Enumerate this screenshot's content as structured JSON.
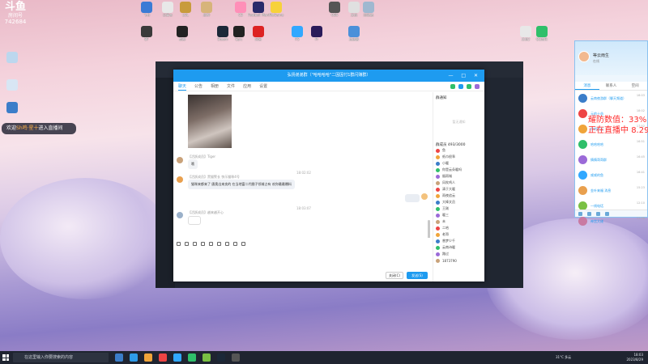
{
  "logo": {
    "title": "斗鱼",
    "room_label": "房间号",
    "room_id": "742684"
  },
  "desktop_icons": [
    {
      "label": "飞书",
      "color": "#3a7bd5"
    },
    {
      "label": "记事本",
      "color": "#e8e8e8"
    },
    {
      "label": "LOL",
      "color": "#c89b3c"
    },
    {
      "label": "原神",
      "color": "#d7b47a"
    },
    {
      "label": "CS",
      "color": "#ff8fb8"
    },
    {
      "label": "Football Manager",
      "color": "#2a2a6a"
    },
    {
      "label": "WeGame",
      "color": "#f7d23a"
    },
    {
      "label": "OBS",
      "color": "#555"
    },
    {
      "label": "文档",
      "color": "#e0e0e0"
    },
    {
      "label": "回收站",
      "color": "#9fb8d0"
    },
    {
      "label": "BF",
      "color": "#3a3a3a"
    },
    {
      "label": "剪映",
      "color": "#222"
    },
    {
      "label": "Steam",
      "color": "#1b2838"
    },
    {
      "label": "Epic",
      "color": "#222"
    },
    {
      "label": "网易",
      "color": "#d22"
    },
    {
      "label": "PS",
      "color": "#31a8ff"
    },
    {
      "label": "Pr",
      "color": "#2a1b5a"
    },
    {
      "label": "加速器",
      "color": "#4a90d9"
    },
    {
      "label": "文档2",
      "color": "#e8e8e8"
    },
    {
      "label": "QQ音乐",
      "color": "#2fbf6a"
    }
  ],
  "overlay": {
    "prefix": "欢迎",
    "user": "Sh鸣·星十",
    "suffix": "进入直播间"
  },
  "chat": {
    "title": "弘扬弟弟群（\"哈哈哈哈\"二因因付1群闪赚群）",
    "tabs": [
      "聊天",
      "公告",
      "相册",
      "文件",
      "应用",
      "设置"
    ],
    "messages": [
      {
        "meta": "【活跃成员】Tiger",
        "text": "哦"
      },
      {
        "meta": "【活跃成员】黑猫警长  快乐猫咪4号",
        "text": "猫咪来都来了 唐奥出来卖的 在当地富二代圈子领域占有 欢你最最爆料"
      },
      {
        "meta": "【活跃成员】越来越开心",
        "text": ""
      }
    ],
    "time1": "18:02:02",
    "time2": "18:03:07",
    "close_label": "关闭(C)",
    "send_label": "发送(S)",
    "notice_title": "群通知",
    "notice_empty": "暂无通知",
    "members_title": "群成员 493/3000",
    "members": [
      "鱼",
      "纸巾很乖",
      "小暖",
      "你是云朵暖吗",
      "烟雨城",
      "风吹鸡人",
      "清于大暖",
      "雨夜追云",
      "大棒文员",
      "王刚",
      "暖三",
      "未",
      "二哈",
      "老哥",
      "曾梦少千",
      "云南诗暖",
      "路过",
      "1873790"
    ]
  },
  "qq_panel": {
    "user_name": "等云雨生",
    "status": "在线",
    "tabs": [
      "消息",
      "联系人",
      "空间"
    ],
    "rows": [
      {
        "name": "云南夜游群（聊天频道）",
        "time": "18:03"
      },
      {
        "name": "元的十益",
        "time": "18:02"
      },
      {
        "name": "你的好友",
        "time": "17:52"
      },
      {
        "name": "哈哈哈哈",
        "time": "16:51"
      },
      {
        "name": "情情哥哥群",
        "time": "16:45"
      },
      {
        "name": "咸咸的鱼",
        "time": "16:41"
      },
      {
        "name": "金叶来福 消息",
        "time": "15:23"
      },
      {
        "name": "一线电话",
        "time": "12:10"
      },
      {
        "name": "神宫大佬",
        "time": "11:38"
      }
    ]
  },
  "stream_overlay": {
    "defense_label": "耀防数值：",
    "defense_value": "33%",
    "live_label": "正在直播中",
    "live_time": "8.29日"
  },
  "taskbar": {
    "search_placeholder": "在这里输入你要搜索的内容",
    "weather": "31°C 多云",
    "time": "18:03",
    "date": "2023/8/29"
  }
}
